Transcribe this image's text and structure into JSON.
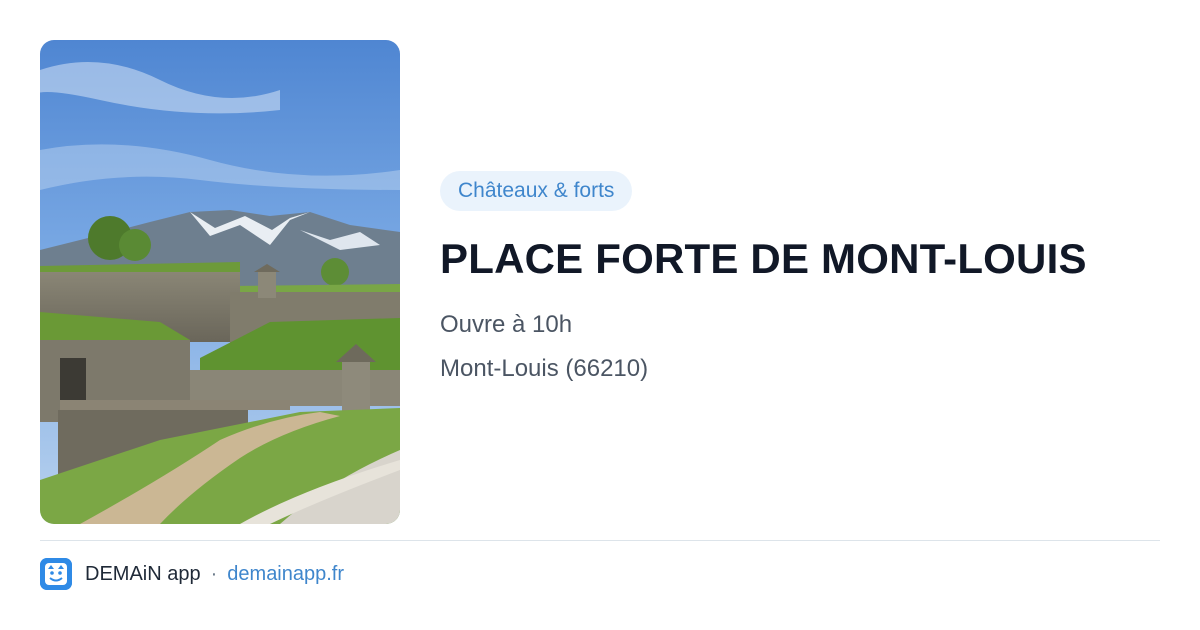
{
  "category": {
    "label": "Châteaux & forts"
  },
  "place": {
    "title": "PLACE FORTE DE MONT-LOUIS",
    "hours": "Ouvre à 10h",
    "location": "Mont-Louis (66210)"
  },
  "photo": {
    "subject": "fortress-photo"
  },
  "footer": {
    "brand": "DEMAiN app",
    "separator": "·",
    "link": "demainapp.fr"
  },
  "colors": {
    "accent": "#3f86cc",
    "pill_bg": "#eaf3fc",
    "title": "#111827",
    "meta": "#4b5563",
    "brand_icon": "#2f8ae6"
  }
}
